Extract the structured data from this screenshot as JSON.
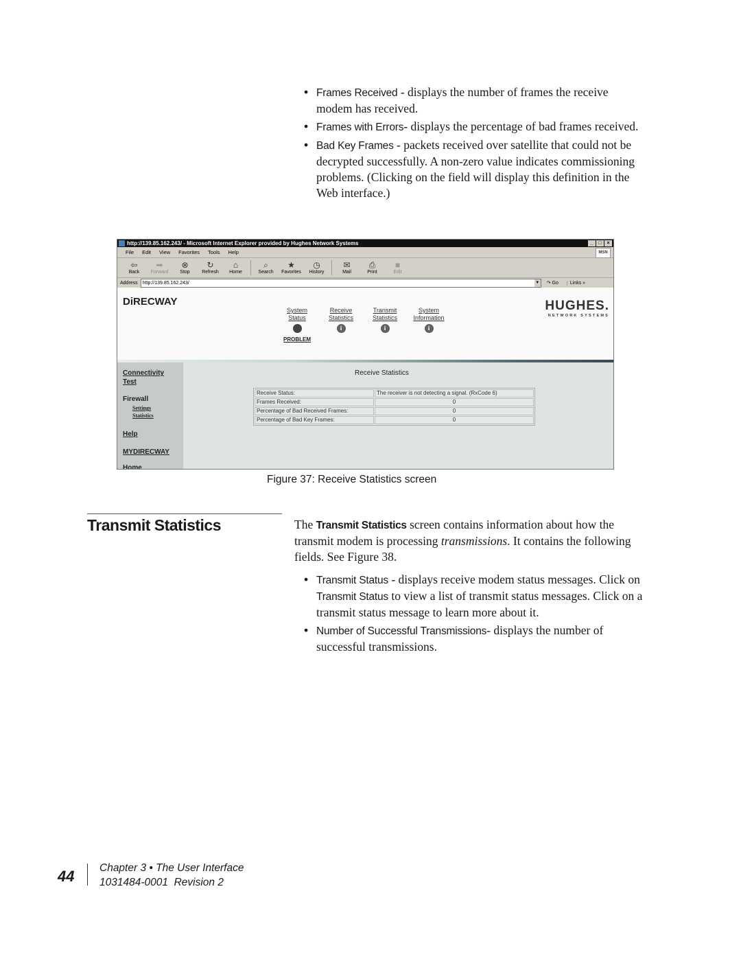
{
  "intro_bullets": [
    {
      "term": "Frames Received",
      "text": " - displays the number of frames the receive modem has received."
    },
    {
      "term": "Frames with Errors",
      "text": "- displays the percentage of bad frames received."
    },
    {
      "term": "Bad Key Frames",
      "text": " - packets received over satellite that could not be decrypted successfully. A non-zero value indicates commissioning problems. (Clicking on the field will display this definition in the Web interface.)"
    }
  ],
  "figure": {
    "caption": "Figure 37:  Receive Statistics screen",
    "browser": {
      "title": "http://139.85.162.243/ - Microsoft Internet Explorer provided by Hughes Network Systems",
      "window_buttons": [
        "_",
        "□",
        "×"
      ],
      "menu": [
        "File",
        "Edit",
        "View",
        "Favorites",
        "Tools",
        "Help"
      ],
      "toolbar": [
        {
          "label": "Back",
          "icon": "⇦",
          "disabled": false
        },
        {
          "label": "Forward",
          "icon": "➡",
          "disabled": true
        },
        {
          "label": "Stop",
          "icon": "⊗",
          "disabled": false
        },
        {
          "label": "Refresh",
          "icon": "↻",
          "disabled": false
        },
        {
          "label": "Home",
          "icon": "⌂",
          "disabled": false
        },
        {
          "label": "Search",
          "icon": "⌕",
          "disabled": false
        },
        {
          "label": "Favorites",
          "icon": "★",
          "disabled": false
        },
        {
          "label": "History",
          "icon": "◷",
          "disabled": false
        },
        {
          "label": "Mail",
          "icon": "✉",
          "disabled": false
        },
        {
          "label": "Print",
          "icon": "⎙",
          "disabled": false
        },
        {
          "label": "Edit",
          "icon": "■",
          "disabled": true
        }
      ],
      "address_label": "Address",
      "address_value": "http://139.85.162.243/",
      "go_label": "Go",
      "links_label": "Links »",
      "throbber": "MSN"
    },
    "web": {
      "logo": "DiRECWAY",
      "brand": "HUGHES.",
      "brand_sub": "NETWORK SYSTEMS",
      "nav": [
        {
          "line1": "System",
          "line2": "Status",
          "indicator": "status-dot",
          "status": "PROBLEM"
        },
        {
          "line1": "Receive",
          "line2": "Statistics",
          "indicator": "info"
        },
        {
          "line1": "Transmit",
          "line2": "Statistics",
          "indicator": "info"
        },
        {
          "line1": "System",
          "line2": "Information",
          "indicator": "info"
        }
      ],
      "sidebar": {
        "connectivity_1": "Connectivity",
        "connectivity_2": "Test",
        "firewall": "Firewall",
        "settings": "Settings",
        "statistics": "Statistics",
        "help": "Help",
        "mydirecway": "MYDIRECWAY",
        "home": "Home"
      },
      "section_title": "Receive Statistics",
      "rows": [
        {
          "label": "Receive Status:",
          "value": "The receiver is not detecting a signal. (RxCode 6)"
        },
        {
          "label": "Frames Received:",
          "value": "0"
        },
        {
          "label": "Percentage of Bad Received Frames:",
          "value": "0"
        },
        {
          "label": "Percentage of Bad Key Frames:",
          "value": "0"
        }
      ]
    }
  },
  "section": {
    "heading": "Transmit Statistics",
    "para_pre": "The ",
    "para_term": "Transmit Statistics",
    "para_mid": " screen contains information about how the transmit modem is processing ",
    "para_em": "transmissions",
    "para_post": ". It contains the following fields. See Figure 38.",
    "bullet1_term": "Transmit Status",
    "bullet1_a": " - displays receive modem status messages. Click on ",
    "bullet1_term2": "Transmit Status",
    "bullet1_b": " to view a list of transmit status messages. Click on a transmit status message to learn more about it.",
    "bullet2_term": "Number of Successful Transmissions",
    "bullet2_text": "- displays the number of successful transmissions."
  },
  "footer": {
    "page_number": "44",
    "chapter": "Chapter 3 • The User Interface",
    "doc_id": "1031484-0001  Revision 2"
  }
}
